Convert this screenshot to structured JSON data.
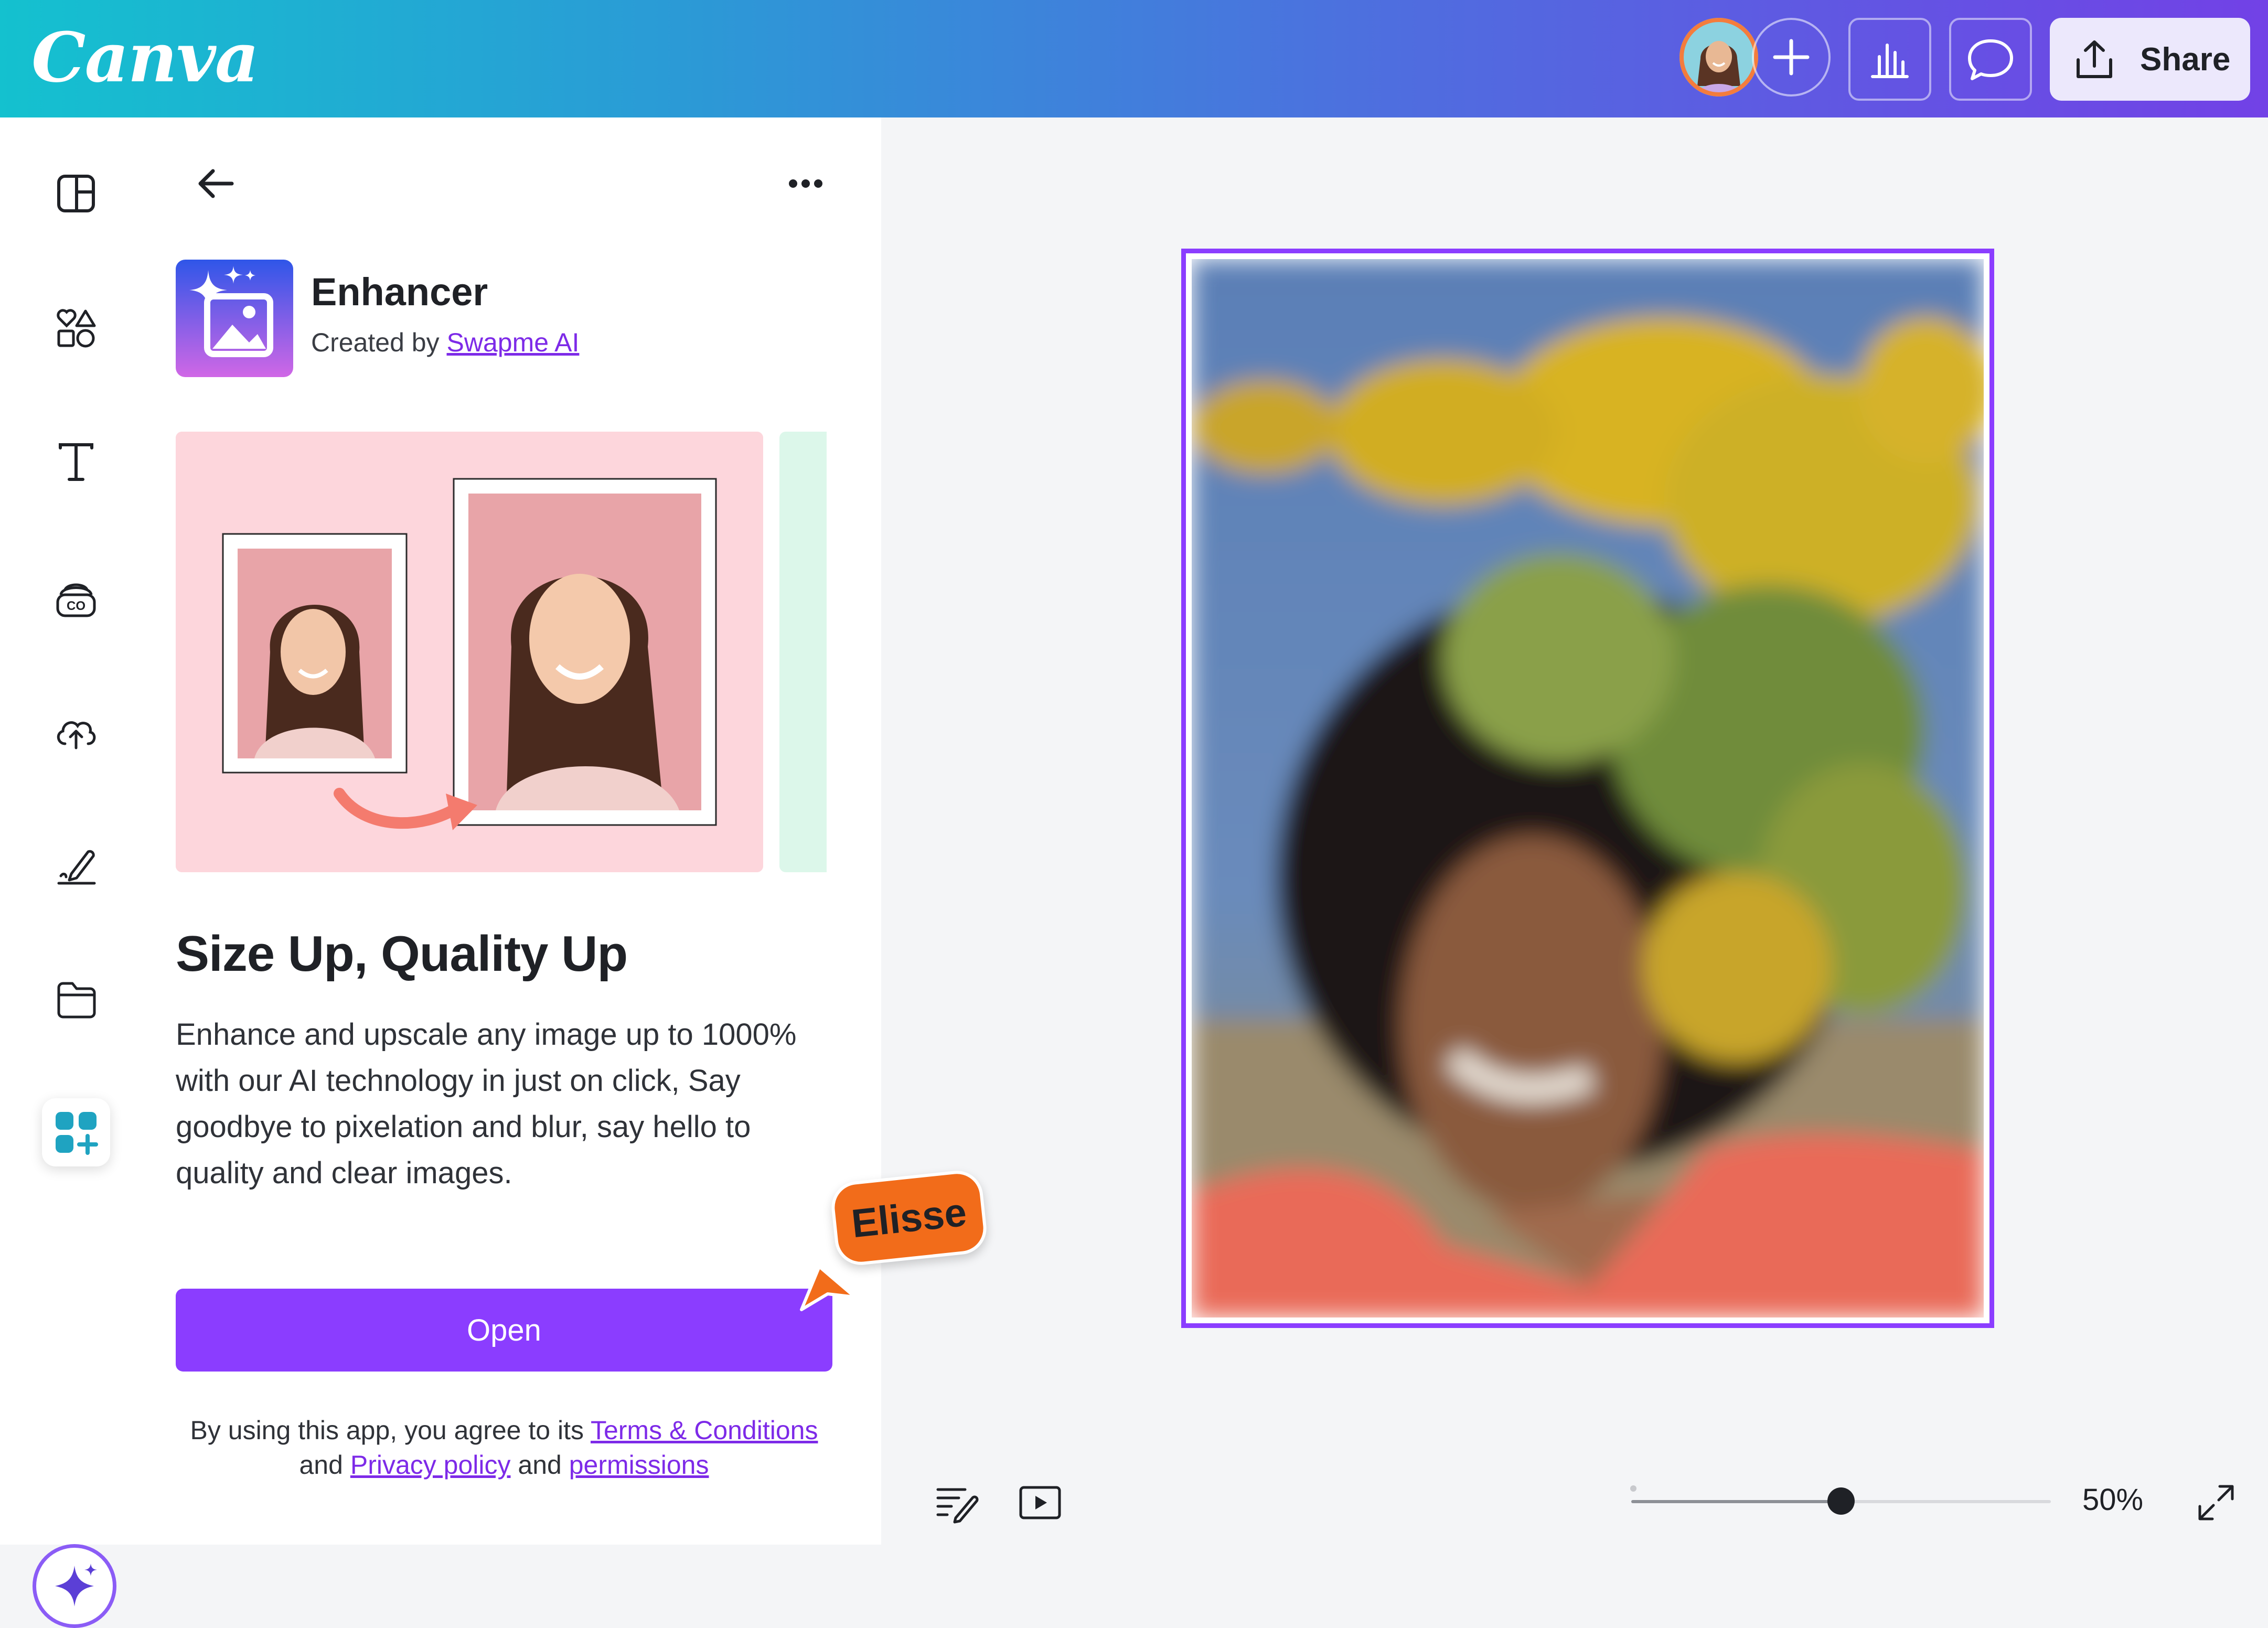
{
  "header": {
    "logo_text": "Canva",
    "share_label": "Share",
    "buttons": {
      "avatar": "user-avatar",
      "add_collaborator": "plus-icon",
      "insights": "bar-chart-icon",
      "comments": "comment-icon",
      "share": "upload-icon"
    }
  },
  "sidebar": {
    "items": [
      {
        "name": "design",
        "icon": "layout-icon"
      },
      {
        "name": "elements",
        "icon": "shapes-icon"
      },
      {
        "name": "text",
        "icon": "text-icon"
      },
      {
        "name": "brand",
        "icon": "brand-icon"
      },
      {
        "name": "uploads",
        "icon": "cloud-upload-icon"
      },
      {
        "name": "draw",
        "icon": "pen-icon"
      },
      {
        "name": "projects",
        "icon": "folder-icon"
      },
      {
        "name": "apps",
        "icon": "apps-icon",
        "active": true
      }
    ],
    "magic_icon": "sparkle-icon"
  },
  "panel": {
    "app_name": "Enhancer",
    "created_by_prefix": "Created by",
    "creator": "Swapme AI",
    "title": "Size Up, Quality Up",
    "description": "Enhance and upscale any image up to 1000% with our AI technology in just on click, Say goodbye to pixelation and blur, say hello to quality and clear images.",
    "open_label": "Open",
    "terms": {
      "prefix": "By using this app, you agree to its",
      "terms_link": "Terms & Conditions",
      "and1": "and",
      "privacy_link": "Privacy policy",
      "and2": "and",
      "permissions_link": "permissions"
    }
  },
  "collaborator": {
    "name": "Elisse",
    "color": "#f26c1a"
  },
  "canvas": {
    "selection_color": "#8b3dff"
  },
  "footer": {
    "zoom_value": "50%",
    "zoom_fraction": 0.5
  },
  "colors": {
    "accent": "#8b3dff",
    "link": "#7d2ae8"
  }
}
